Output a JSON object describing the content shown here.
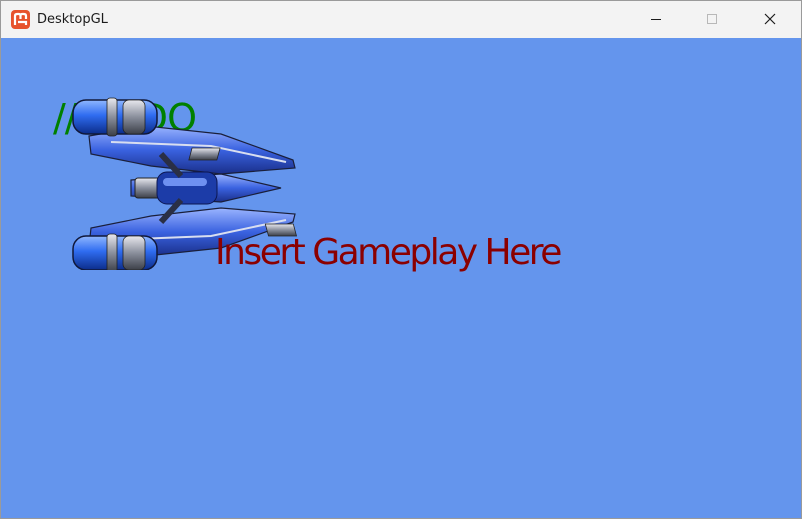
{
  "window": {
    "title": "DesktopGL",
    "app_icon": "monogame-icon",
    "controls": [
      "minimize-icon",
      "maximize-icon",
      "close-icon"
    ]
  },
  "game": {
    "clear_color": "#6495ED",
    "todo_text": "// TODO",
    "todo_color": "#008000",
    "gameplay_text": "Insert Gameplay Here",
    "gameplay_color": "#8B0000",
    "sprite": "spaceship-sprite"
  }
}
